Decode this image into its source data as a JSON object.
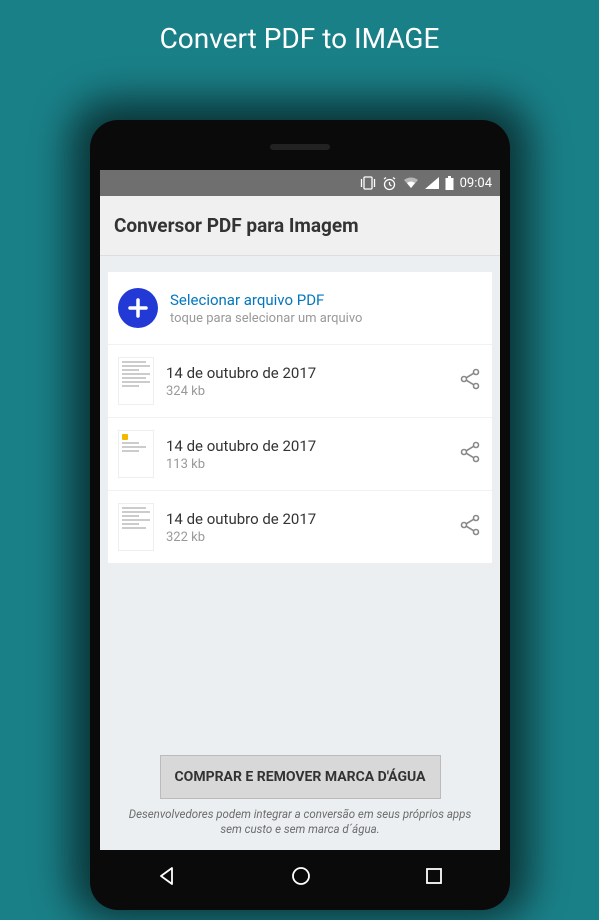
{
  "promo": {
    "title": "Convert PDF to IMAGE"
  },
  "status_bar": {
    "time": "09:04"
  },
  "header": {
    "title": "Conversor PDF para Imagem"
  },
  "select_row": {
    "title": "Selecionar arquivo PDF",
    "subtitle": "toque para selecionar um arquivo"
  },
  "files": [
    {
      "date": "14 de outubro de 2017",
      "size": "324 kb"
    },
    {
      "date": "14 de outubro de 2017",
      "size": "113 kb"
    },
    {
      "date": "14 de outubro de 2017",
      "size": "322 kb"
    }
  ],
  "footer": {
    "button": "COMPRAR E REMOVER MARCA D'ÁGUA",
    "note": "Desenvolvedores podem integrar a conversão em seus próprios apps sem custo e sem marca d´água."
  }
}
